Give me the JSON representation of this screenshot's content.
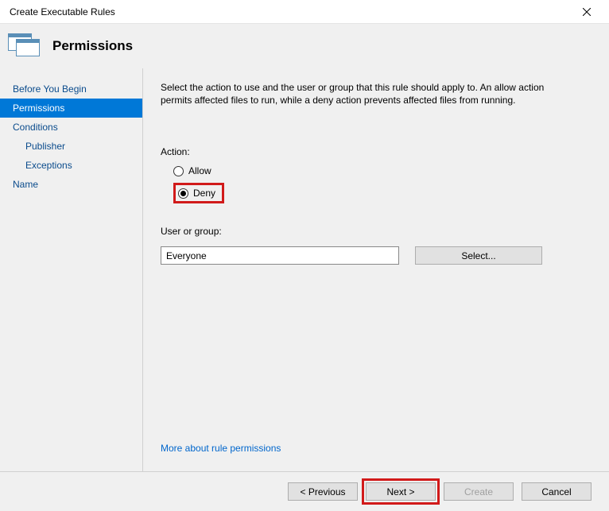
{
  "window": {
    "title": "Create Executable Rules"
  },
  "header": {
    "title": "Permissions"
  },
  "sidebar": {
    "items": [
      {
        "label": "Before You Begin",
        "selected": false,
        "indent": 0
      },
      {
        "label": "Permissions",
        "selected": true,
        "indent": 0
      },
      {
        "label": "Conditions",
        "selected": false,
        "indent": 0
      },
      {
        "label": "Publisher",
        "selected": false,
        "indent": 1
      },
      {
        "label": "Exceptions",
        "selected": false,
        "indent": 1
      },
      {
        "label": "Name",
        "selected": false,
        "indent": 0
      }
    ]
  },
  "content": {
    "description": "Select the action to use and the user or group that this rule should apply to. An allow action permits affected files to run, while a deny action prevents affected files from running.",
    "action_label": "Action:",
    "allow_label": "Allow",
    "deny_label": "Deny",
    "selected_action": "Deny",
    "user_group_label": "User or group:",
    "user_group_value": "Everyone",
    "select_button": "Select...",
    "more_link": "More about rule permissions"
  },
  "footer": {
    "previous": "< Previous",
    "next": "Next >",
    "create": "Create",
    "cancel": "Cancel"
  }
}
